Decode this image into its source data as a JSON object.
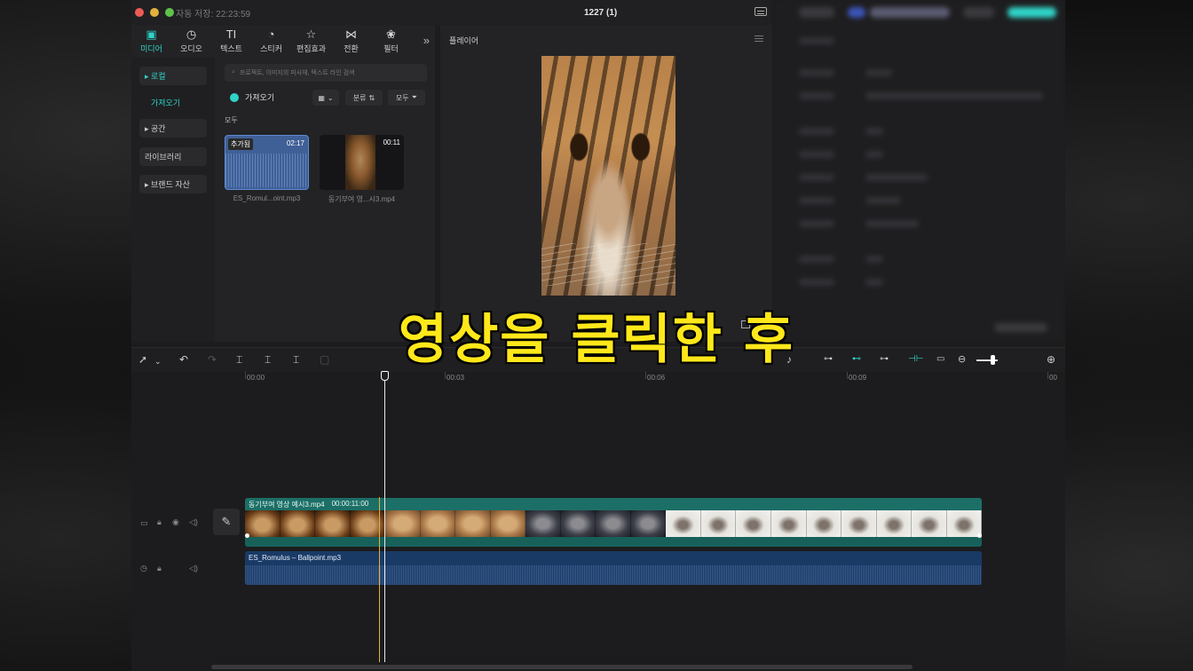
{
  "titlebar": {
    "autosave": "자동 저장: 22:23:59",
    "title": "1227 (1)"
  },
  "media_tabs": [
    {
      "label": "미디어",
      "icon": "media-icon"
    },
    {
      "label": "오디오",
      "icon": "audio-icon"
    },
    {
      "label": "텍스트",
      "icon": "text-icon"
    },
    {
      "label": "스티커",
      "icon": "sticker-icon"
    },
    {
      "label": "편집효과",
      "icon": "effects-icon"
    },
    {
      "label": "전환",
      "icon": "transition-icon"
    },
    {
      "label": "필터",
      "icon": "filter-icon"
    }
  ],
  "sidebar": {
    "local": "▸ 로컬",
    "import_link": "가져오기",
    "space": "▸ 공간",
    "library": "라이브러리",
    "brand": "▸ 브랜드 자산"
  },
  "media": {
    "search_placeholder": "프로젝트, 이미지의 피사체, 텍스트 라인 검색",
    "import_button": "가져오기",
    "sort_label": "분류",
    "filter_label": "모두",
    "section": "모두",
    "items": [
      {
        "name": "ES_Romul...oint.mp3",
        "duration": "02:17",
        "badge": "추가됨",
        "type": "audio"
      },
      {
        "name": "동기부여 영...시3.mp4",
        "duration": "00:11",
        "type": "video"
      }
    ]
  },
  "player": {
    "title": "플레이어"
  },
  "timeline": {
    "ruler": [
      "00:00",
      "00:03",
      "00:06",
      "00:09",
      "00"
    ],
    "video_clip": {
      "name": "동기부여 영상 예시3.mp4",
      "duration": "00:00:11:00"
    },
    "audio_clip": {
      "name": "ES_Romulus – Ballpoint.mp3"
    }
  },
  "caption": "영상을 클릭한 후",
  "colors": {
    "accent": "#2fd3c7",
    "video_track": "#1c6f67",
    "audio_track": "#1a3a66",
    "caption": "#ffe81a"
  }
}
